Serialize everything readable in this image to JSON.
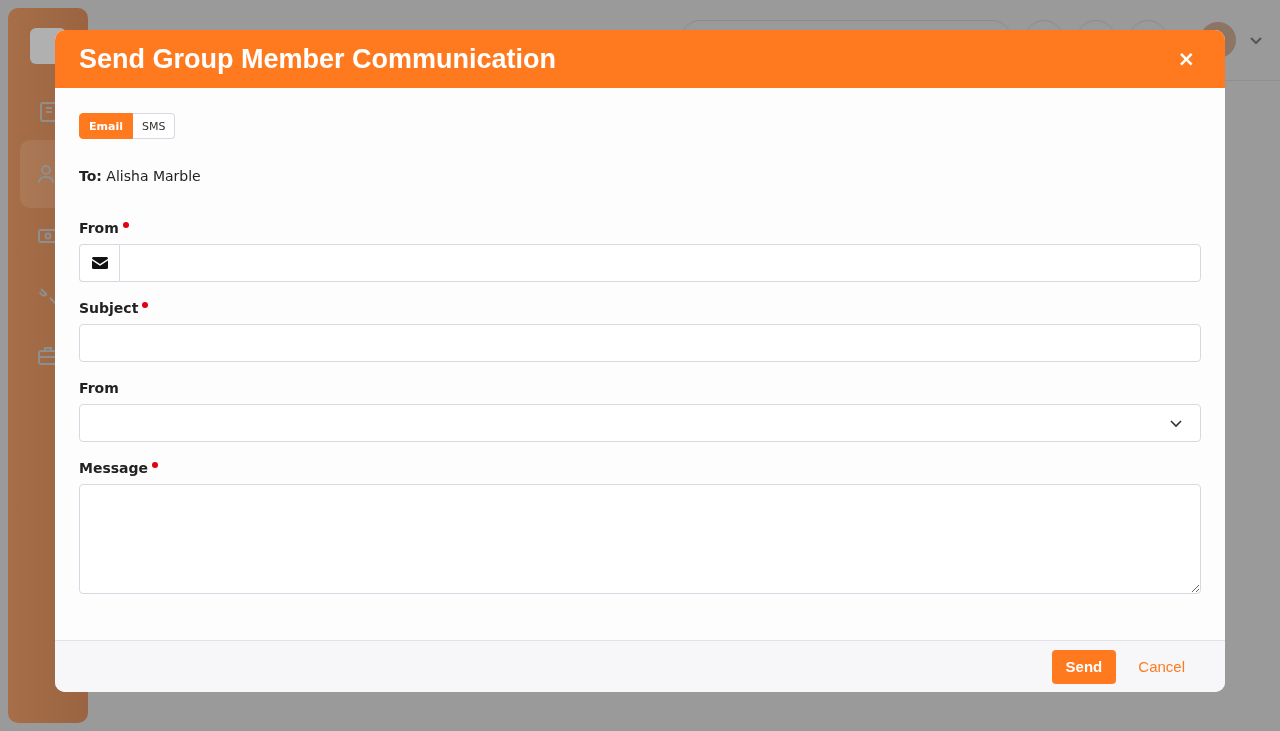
{
  "modal": {
    "title": "Send Group Member Communication",
    "close": "×",
    "tabs": [
      {
        "label": "Email",
        "selected": true
      },
      {
        "label": "SMS",
        "selected": false
      }
    ],
    "recipient": {
      "label": "To:",
      "value": "Alisha Marble"
    },
    "fields": [
      {
        "kind": "email",
        "label": "From",
        "required": true
      },
      {
        "kind": "text",
        "label": "Subject",
        "required": true
      },
      {
        "kind": "select",
        "label": "From",
        "required": false
      },
      {
        "kind": "textarea",
        "label": "Message",
        "required": true
      }
    ],
    "buttons": [
      {
        "kind": "primary",
        "label": "Send"
      },
      {
        "kind": "link",
        "label": "Cancel"
      }
    ]
  }
}
